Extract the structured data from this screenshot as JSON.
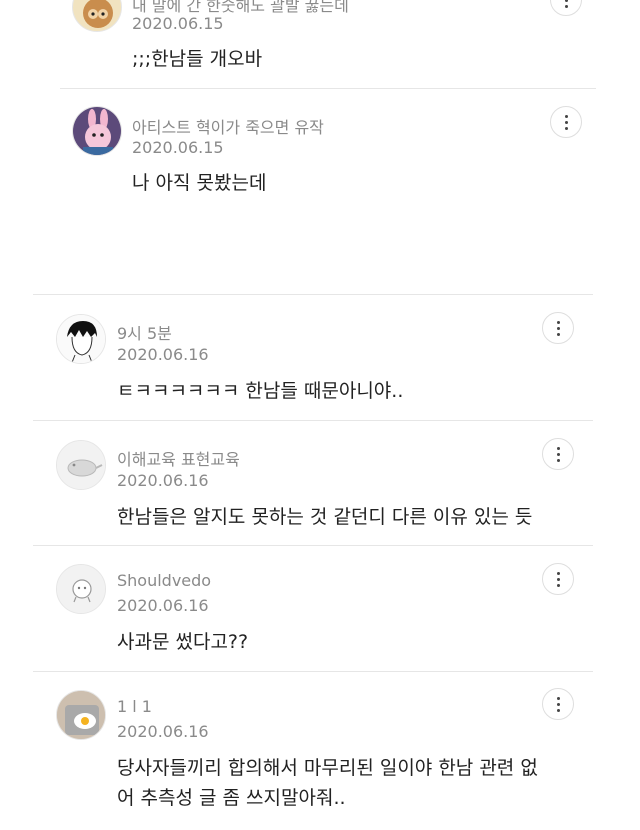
{
  "replies": [
    {
      "author": "내 말에 간 한숫해도 괄발 꿇는데",
      "date": "2020.06.15",
      "text": ";;;한남들 개오바",
      "avatar_icon": "monkey-avatar-icon"
    },
    {
      "author": "아티스트 혁이가 죽으면 유작",
      "date": "2020.06.15",
      "text": "나 아직 못봤는데",
      "avatar_icon": "pink-bunny-avatar-icon"
    }
  ],
  "comments": [
    {
      "author": "9시 5분",
      "date": "2020.06.16",
      "text": "ㅌㅋㅋㅋㅋㅋㅋ 한남들 때문아니야..",
      "avatar_icon": "drawn-boy-avatar-icon"
    },
    {
      "author": "이해교육 표현교육",
      "date": "2020.06.16",
      "text": "한남들은 알지도 못하는 것 같던디 다른 이유 있는 듯",
      "avatar_icon": "default-lizard-avatar-icon"
    },
    {
      "author": "Shouldvedo",
      "date": "2020.06.16",
      "text": "사과문 썼다고??",
      "avatar_icon": "default-character-avatar-icon"
    },
    {
      "author": "1 l 1",
      "date": "2020.06.16",
      "text": "당사자들끼리 합의해서 마무리된 일이야 한남 관련 없\n어 추측성 글 좀 쓰지말아줘..",
      "avatar_icon": "fried-egg-avatar-icon"
    }
  ],
  "more_icon": "vertical-ellipsis-icon",
  "colors": {
    "meta": "#8a8a8a",
    "text": "#222222",
    "divider": "#e6e6e6"
  }
}
